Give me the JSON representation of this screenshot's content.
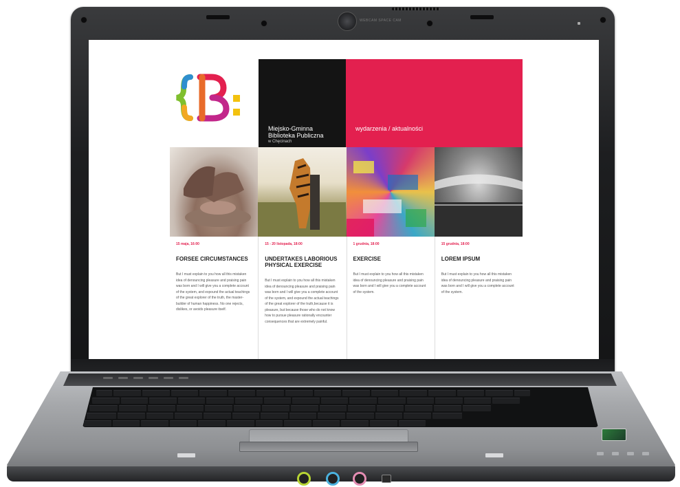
{
  "laptop": {
    "webcam_label": "WEBCAM SPACE CAM"
  },
  "site": {
    "logo_alt": "{B: logo",
    "org": {
      "line1": "Miejsko-Gminna",
      "line2": "Biblioteka Publiczna",
      "line3": "w Chęcinach"
    },
    "news_label": "wydarzenia / aktualności",
    "accent_color": "#e3204f",
    "events": [
      {
        "date": "15 maja, 16:00",
        "title": "FORSEE CIRCUMSTANCES",
        "body": "But I must explain to you how all this mistaken idea of denouncing pleasure and praising pain was born and I will give you a complete account of the system, and expound the actual teachings of the great explorer of the truth, the master-builder of human happiness. No one rejects, dislikes, or avoids pleasure itself.",
        "image": "pottery-hands"
      },
      {
        "date": "15 - 20 listopada, 18:00",
        "title": "UNDERTAKES LABORIOUS PHYSICAL EXERCISE",
        "body": "But I must explain to you how all this mistaken idea of denouncing pleasure and praising pain was born and I will give you a complete account of the system, and expound the actual teachings of the great explorer of the truth,because it is pleasure, but because those who do not know how to pursue pleasure rationally encounter consequences that are extremely painful.",
        "image": "tiger-hug"
      },
      {
        "date": "1 grudnia, 18:00",
        "title": "EXERCISE",
        "body": "But I must explain to you how all this mistaken idea of denouncing pleasure and praising pain was born and I will give you a complete account of the system.",
        "image": "colorful-abstract"
      },
      {
        "date": "15 grudnia, 18:00",
        "title": "LOREM IPSUM",
        "body": "But I must explain to you how all this mistaken idea of denouncing pleasure and praising pain was born and I will give you a complete account of the system.",
        "image": "stadium-bw"
      }
    ]
  }
}
